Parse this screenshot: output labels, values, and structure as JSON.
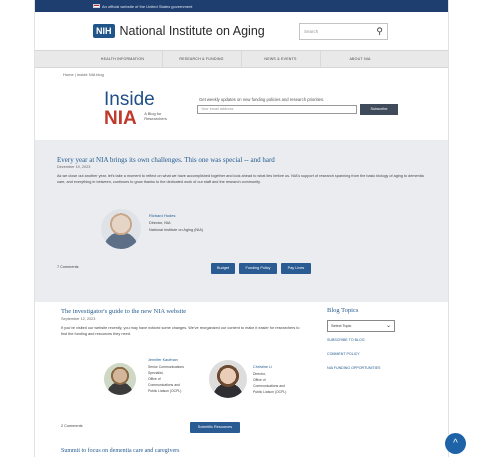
{
  "topbar": {
    "gov_text": "An official website of the United States government"
  },
  "header": {
    "logo_abbrev": "NIH",
    "logo_text": "National Institute on Aging",
    "search_placeholder": "Search"
  },
  "nav": {
    "items": [
      "HEALTH INFORMATION",
      "RESEARCH & FUNDING",
      "NEWS & EVENTS",
      "ABOUT NIA"
    ]
  },
  "breadcrumb": "Home | Inside NIA blog",
  "banner": {
    "word1": "Inside",
    "word2": "NIA",
    "tagline": "A Blog for Researchers",
    "subscribe_text": "Get weekly updates on new funding policies and research priorities.",
    "email_placeholder": "Your email address",
    "subscribe_label": "Subscribe"
  },
  "featured": {
    "title": "Every year at NIA brings its own challenges. This one was special -- and hard",
    "date": "December 19, 2023",
    "excerpt": "As we close out another year, let's take a moment to reflect on what we have accomplished together and look ahead to what lies before us. NIA's support of research spanning from the basic biology of aging to dementia care, and everything in between, continues to grow thanks to the dedicated work of our staff and the research community.",
    "author_name": "Richard Hodes",
    "author_role": "Director, NIA",
    "author_org": "National Institute on Aging (NIA)",
    "comments": "7 Comments",
    "tags": [
      "Budget",
      "Funding Policy",
      "Pay Lines"
    ]
  },
  "post2": {
    "title": "The investigator's guide to the new NIA website",
    "date": "September 12, 2023",
    "excerpt": "If you've visited our website recently, you may have noticed some changes. We've reorganized our content to make it easier for researchers to find the funding and resources they need.",
    "author1": {
      "name": "Jennifer Kaufman",
      "lines": [
        "Senior Communications",
        "Specialist,",
        "Office of",
        "Communications and",
        "Public Liaison (OCPL)"
      ]
    },
    "author2": {
      "name": "Christine Li",
      "lines": [
        "Director,",
        "Office of",
        "Communications and",
        "Public Liaison (OCPL)"
      ]
    },
    "comments": "2 Comments",
    "tag": "Scientific Resources"
  },
  "post3": {
    "title": "Summit to focus on dementia care and caregivers"
  },
  "sidebar": {
    "title": "Blog Topics",
    "select_value": "Select Topic",
    "links": [
      "SUBSCRIBE TO BLOG",
      "COMMENT POLICY",
      "NIA FUNDING OPPORTUNITIES"
    ]
  },
  "back_to_top": "^"
}
